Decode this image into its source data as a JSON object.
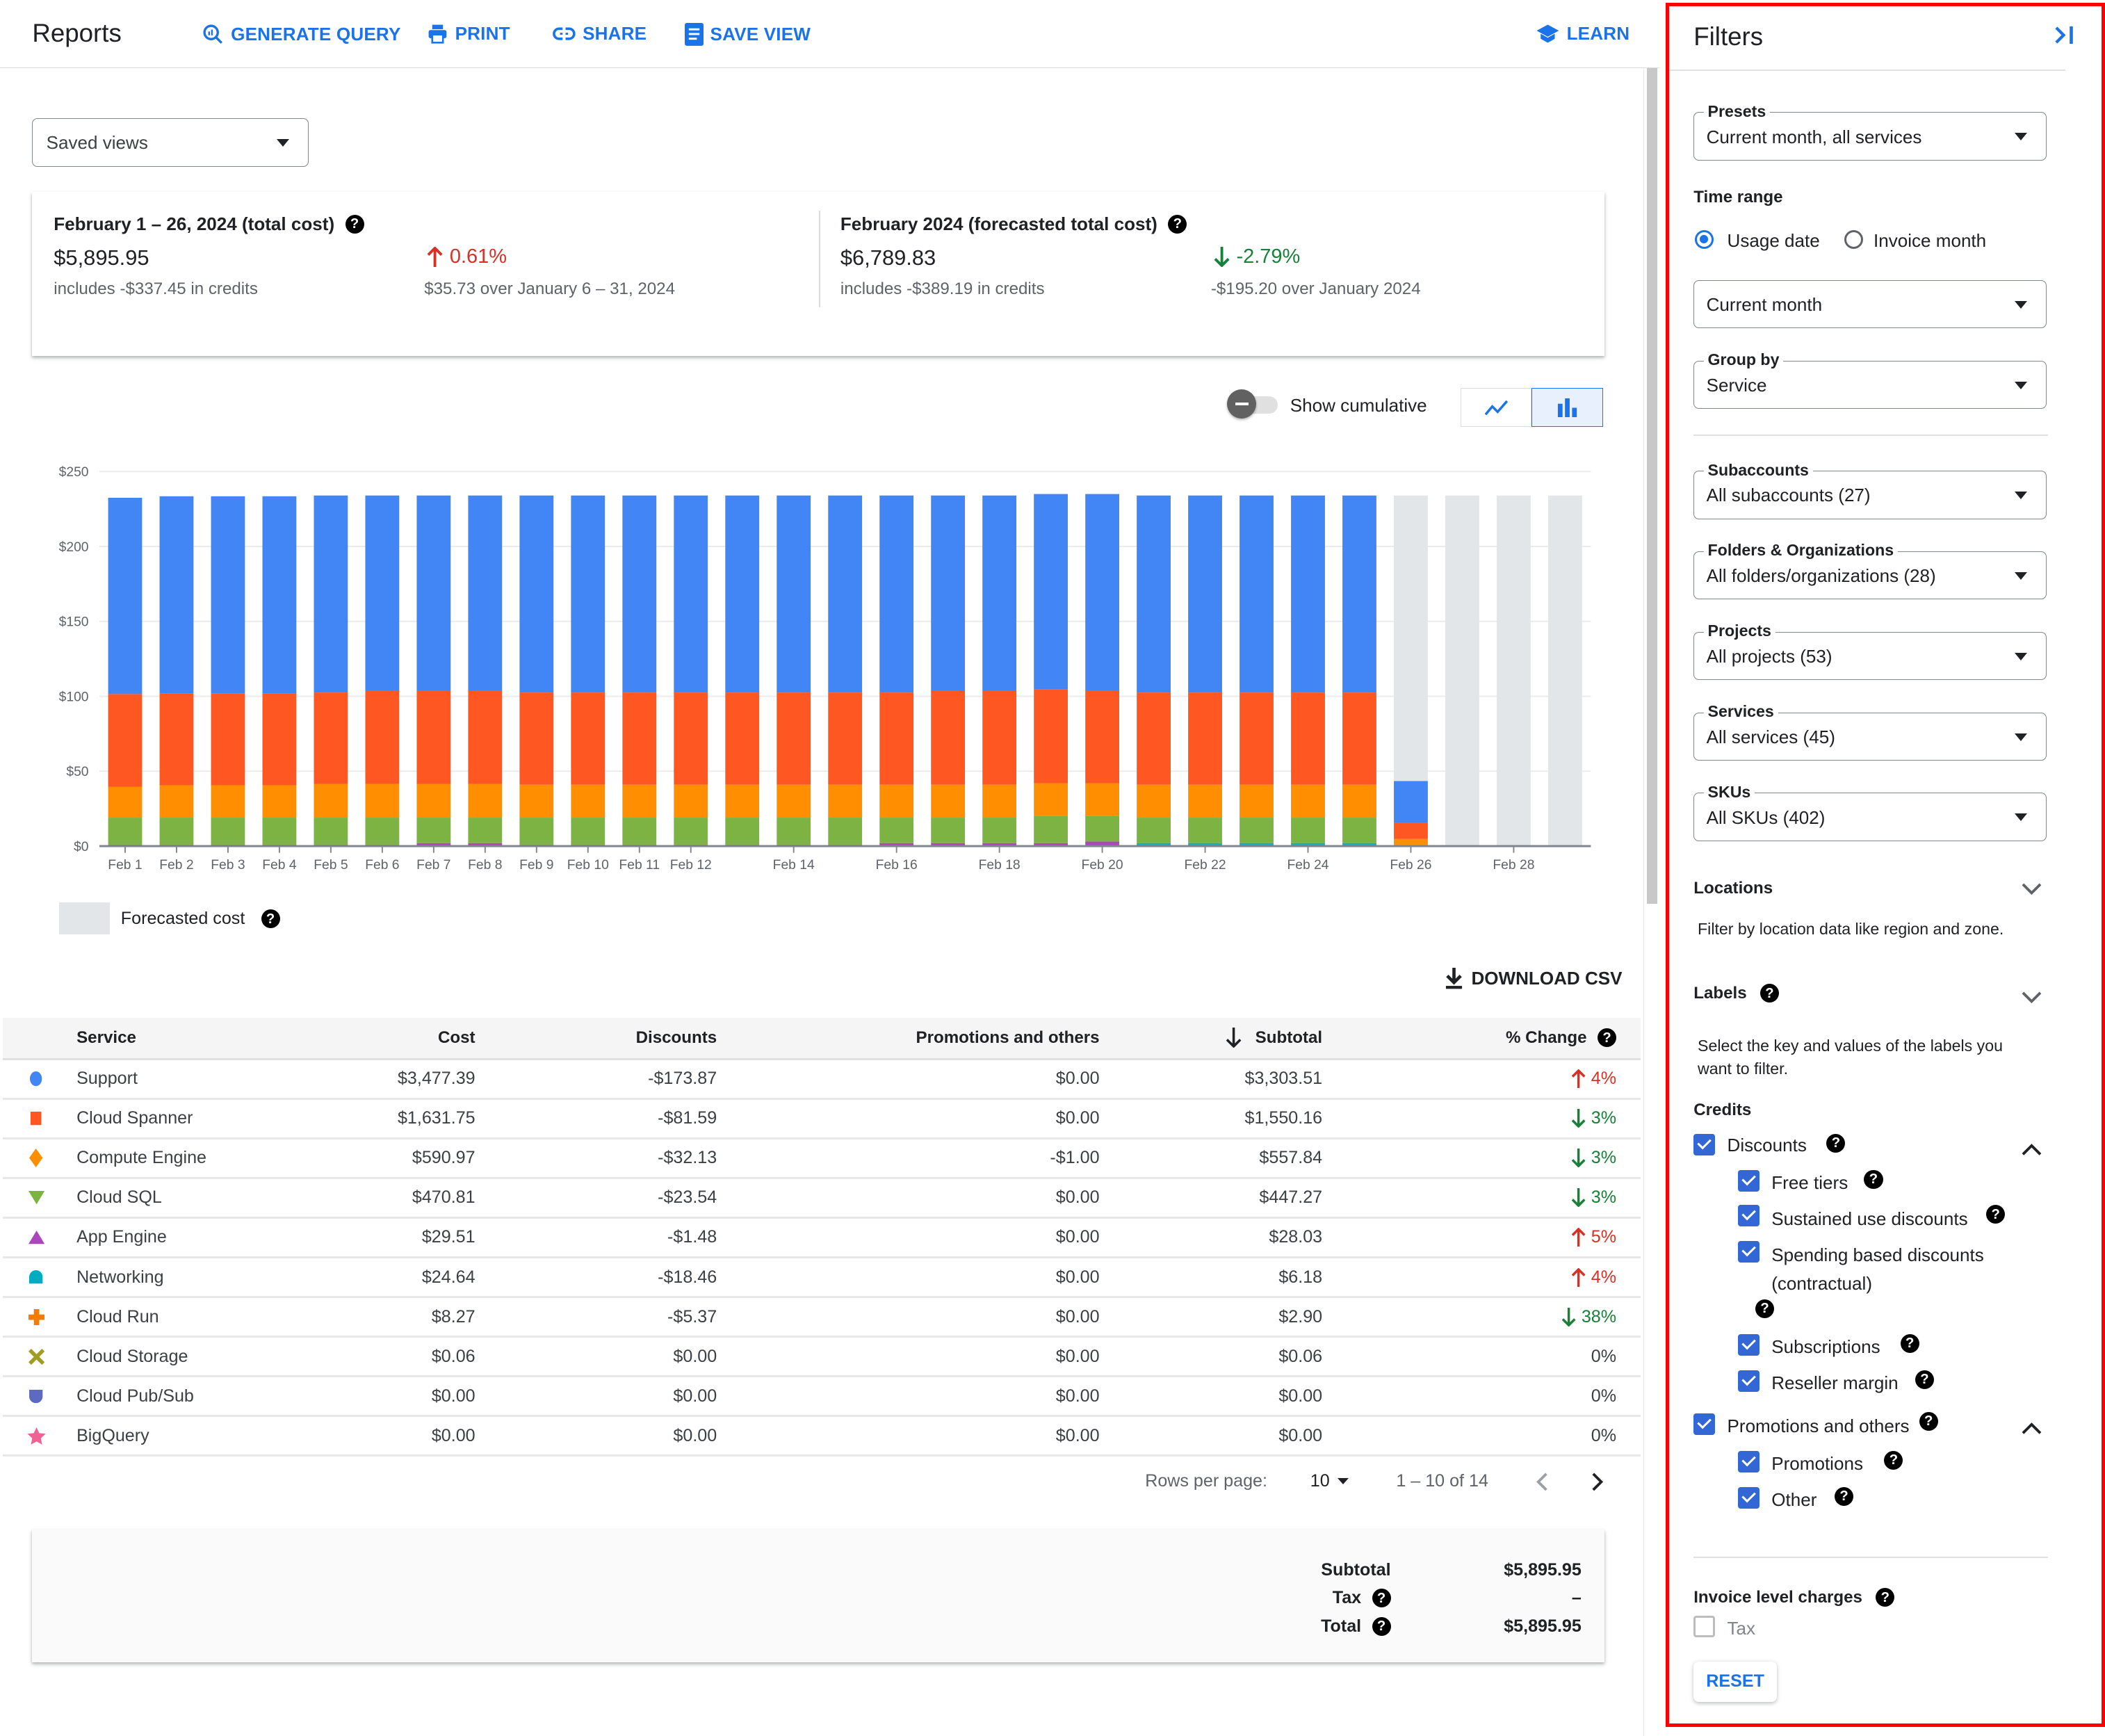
{
  "header": {
    "title": "Reports",
    "generate_query": "GENERATE QUERY",
    "print": "PRINT",
    "share": "SHARE",
    "save_view": "SAVE VIEW",
    "learn": "LEARN"
  },
  "saved_views": {
    "value": "Saved views"
  },
  "summary": {
    "left": {
      "heading": "February 1 – 26, 2024 (total cost)",
      "amount": "$5,895.95",
      "credits": "includes -$337.45 in credits",
      "change": "0.61%",
      "change_direction": "up",
      "comparison": "$35.73 over January 6 – 31, 2024"
    },
    "right": {
      "heading": "February 2024 (forecasted total cost)",
      "amount": "$6,789.83",
      "credits": "includes -$389.19 in credits",
      "change": "-2.79%",
      "change_direction": "down",
      "comparison": "-$195.20 over January 2024"
    }
  },
  "chart_controls": {
    "show_cumulative_label": "Show cumulative",
    "show_cumulative_on": false,
    "chart_type_options": [
      "line",
      "bar"
    ],
    "chart_type_selected": "bar"
  },
  "chart_data": {
    "type": "bar",
    "stacked": true,
    "title": "",
    "xlabel": "",
    "ylabel": "",
    "ylim": [
      0,
      250
    ],
    "yticks": [
      "$0",
      "$50",
      "$100",
      "$150",
      "$200",
      "$250"
    ],
    "ytick_values": [
      0,
      50,
      100,
      150,
      200,
      250
    ],
    "grid": true,
    "categories": [
      "Feb 1",
      "Feb 2",
      "Feb 3",
      "Feb 4",
      "Feb 5",
      "Feb 6",
      "Feb 7",
      "Feb 8",
      "Feb 9",
      "Feb 10",
      "Feb 11",
      "Feb 12",
      "Feb 13",
      "Feb 14",
      "Feb 15",
      "Feb 16",
      "Feb 17",
      "Feb 18",
      "Feb 19",
      "Feb 20",
      "Feb 21",
      "Feb 22",
      "Feb 23",
      "Feb 24",
      "Feb 25",
      "Feb 26",
      "Feb 27",
      "Feb 28",
      "Feb 29"
    ],
    "tick_labels": [
      "Feb 1",
      "Feb 2",
      "Feb 3",
      "Feb 4",
      "Feb 5",
      "Feb 6",
      "Feb 7",
      "Feb 8",
      "Feb 9",
      "Feb 10",
      "Feb 11",
      "Feb 12",
      "",
      "Feb 14",
      "",
      "Feb 16",
      "",
      "Feb 18",
      "",
      "Feb 20",
      "",
      "Feb 22",
      "",
      "Feb 24",
      "",
      "Feb 26",
      "",
      "Feb 28",
      ""
    ],
    "series": [
      {
        "name": "App Engine",
        "color": "#ab47bc",
        "values": [
          1,
          1,
          1,
          1,
          1,
          1,
          2,
          2,
          1,
          1,
          1,
          1,
          1,
          1,
          1,
          2,
          2,
          2,
          2,
          3,
          1,
          1,
          1,
          1,
          1,
          0,
          0,
          0,
          0
        ]
      },
      {
        "name": "Networking",
        "color": "#00acc1",
        "values": [
          0,
          0,
          0,
          0,
          0,
          0,
          0,
          0,
          0,
          0,
          0,
          0,
          0,
          0,
          0,
          0,
          0,
          0,
          0,
          0,
          1,
          1,
          1,
          1,
          1,
          0,
          0,
          0,
          0
        ]
      },
      {
        "name": "Cloud SQL",
        "color": "#7cb342",
        "values": [
          18,
          18,
          18,
          18,
          18,
          18,
          17,
          17,
          18,
          18,
          18,
          18,
          18,
          18,
          18,
          17,
          17,
          17,
          18,
          17,
          17,
          17,
          17,
          17,
          17,
          1,
          0,
          0,
          0
        ]
      },
      {
        "name": "Compute Engine",
        "color": "#ff8f00",
        "values": [
          20.5,
          21.5,
          21.5,
          21.5,
          22.5,
          22.5,
          22.5,
          22.5,
          22,
          22,
          22,
          22,
          22,
          22,
          22,
          22,
          22,
          22,
          22,
          22,
          22,
          22,
          22,
          22,
          22,
          3.8,
          0,
          0,
          0
        ]
      },
      {
        "name": "Cloud Spanner",
        "color": "#ff5722",
        "values": [
          62,
          61.5,
          61.5,
          61.5,
          61,
          62,
          62,
          62,
          61.5,
          61.5,
          61.5,
          61.5,
          61.5,
          61.5,
          61.5,
          61.5,
          62.5,
          62.5,
          62.5,
          61.5,
          61.5,
          61.5,
          61.5,
          61.5,
          61.5,
          10.6,
          0,
          0,
          0
        ]
      },
      {
        "name": "Support",
        "color": "#4285f4",
        "values": [
          131,
          131.5,
          131.5,
          131.5,
          131.5,
          130.5,
          130.5,
          130.5,
          131.5,
          131.5,
          131.5,
          131.5,
          131.5,
          131.5,
          131.5,
          131.5,
          130.5,
          130.5,
          130.5,
          131.5,
          131.5,
          131.5,
          131.5,
          131.5,
          131.5,
          28,
          0,
          0,
          0
        ]
      }
    ],
    "forecast": {
      "name": "Forecasted cost",
      "color": "#e3e6e8",
      "values": [
        0,
        0,
        0,
        0,
        0,
        0,
        0,
        0,
        0,
        0,
        0,
        0,
        0,
        0,
        0,
        0,
        0,
        0,
        0,
        0,
        0,
        0,
        0,
        0,
        0,
        234,
        234,
        234,
        234
      ]
    },
    "legend": [
      {
        "label": "Forecasted cost",
        "color": "#e3e6e8"
      }
    ],
    "legend_position": "bottom-left"
  },
  "download_csv": "DOWNLOAD CSV",
  "table": {
    "columns": [
      "Service",
      "Cost",
      "Discounts",
      "Promotions and others",
      "Subtotal",
      "% Change"
    ],
    "sort_column": "Subtotal",
    "sort_direction": "desc",
    "rows": [
      {
        "icon": "circle",
        "color": "#4285f4",
        "service": "Support",
        "cost": "$3,477.39",
        "discounts": "-$173.87",
        "promotions": "$0.00",
        "subtotal": "$3,303.51",
        "change": "4%",
        "direction": "up"
      },
      {
        "icon": "square",
        "color": "#ff5722",
        "service": "Cloud Spanner",
        "cost": "$1,631.75",
        "discounts": "-$81.59",
        "promotions": "$0.00",
        "subtotal": "$1,550.16",
        "change": "3%",
        "direction": "down"
      },
      {
        "icon": "diamond",
        "color": "#ff8f00",
        "service": "Compute Engine",
        "cost": "$590.97",
        "discounts": "-$32.13",
        "promotions": "-$1.00",
        "subtotal": "$557.84",
        "change": "3%",
        "direction": "down"
      },
      {
        "icon": "triangle-down",
        "color": "#7cb342",
        "service": "Cloud SQL",
        "cost": "$470.81",
        "discounts": "-$23.54",
        "promotions": "$0.00",
        "subtotal": "$447.27",
        "change": "3%",
        "direction": "down"
      },
      {
        "icon": "triangle-up",
        "color": "#ab47bc",
        "service": "App Engine",
        "cost": "$29.51",
        "discounts": "-$1.48",
        "promotions": "$0.00",
        "subtotal": "$28.03",
        "change": "5%",
        "direction": "up"
      },
      {
        "icon": "dome",
        "color": "#00acc1",
        "service": "Networking",
        "cost": "$24.64",
        "discounts": "-$18.46",
        "promotions": "$0.00",
        "subtotal": "$6.18",
        "change": "4%",
        "direction": "up"
      },
      {
        "icon": "plus",
        "color": "#f57c00",
        "service": "Cloud Run",
        "cost": "$8.27",
        "discounts": "-$5.37",
        "promotions": "$0.00",
        "subtotal": "$2.90",
        "change": "38%",
        "direction": "down"
      },
      {
        "icon": "cross",
        "color": "#9e9d24",
        "service": "Cloud Storage",
        "cost": "$0.06",
        "discounts": "$0.00",
        "promotions": "$0.00",
        "subtotal": "$0.06",
        "change": "0%",
        "direction": "none"
      },
      {
        "icon": "shield",
        "color": "#5c6bc0",
        "service": "Cloud Pub/Sub",
        "cost": "$0.00",
        "discounts": "$0.00",
        "promotions": "$0.00",
        "subtotal": "$0.00",
        "change": "0%",
        "direction": "none"
      },
      {
        "icon": "star",
        "color": "#f06292",
        "service": "BigQuery",
        "cost": "$0.00",
        "discounts": "$0.00",
        "promotions": "$0.00",
        "subtotal": "$0.00",
        "change": "0%",
        "direction": "none"
      }
    ]
  },
  "pagination": {
    "rows_per_page_label": "Rows per page:",
    "rows_per_page": "10",
    "range": "1 – 10 of 14"
  },
  "totals": {
    "subtotal_label": "Subtotal",
    "subtotal": "$5,895.95",
    "tax_label": "Tax",
    "tax": "–",
    "total_label": "Total",
    "total": "$5,895.95"
  },
  "filters": {
    "title": "Filters",
    "presets": {
      "label": "Presets",
      "value": "Current month, all services"
    },
    "time_range": {
      "label": "Time range",
      "options": [
        "Usage date",
        "Invoice month"
      ],
      "selected": "Usage date",
      "value": "Current month"
    },
    "group_by": {
      "label": "Group by",
      "value": "Service"
    },
    "subaccounts": {
      "label": "Subaccounts",
      "value": "All subaccounts (27)"
    },
    "folders": {
      "label": "Folders & Organizations",
      "value": "All folders/organizations (28)"
    },
    "projects": {
      "label": "Projects",
      "value": "All projects (53)"
    },
    "services": {
      "label": "Services",
      "value": "All services (45)"
    },
    "skus": {
      "label": "SKUs",
      "value": "All SKUs (402)"
    },
    "locations": {
      "label": "Locations",
      "description": "Filter by location data like region and zone."
    },
    "labels": {
      "label": "Labels",
      "description": "Select the key and values of the labels you want to filter."
    },
    "credits": {
      "label": "Credits",
      "discounts": {
        "label": "Discounts",
        "checked": true
      },
      "discount_items": [
        {
          "label": "Free tiers",
          "checked": true
        },
        {
          "label": "Sustained use discounts",
          "checked": true
        },
        {
          "label": "Spending based discounts (contractual)",
          "checked": true
        },
        {
          "label": "Subscriptions",
          "checked": true
        },
        {
          "label": "Reseller margin",
          "checked": true
        }
      ],
      "promotions": {
        "label": "Promotions and others",
        "checked": true
      },
      "promotion_items": [
        {
          "label": "Promotions",
          "checked": true
        },
        {
          "label": "Other",
          "checked": true
        }
      ]
    },
    "invoice_level": {
      "label": "Invoice level charges",
      "tax_label": "Tax",
      "tax_checked": false
    },
    "reset": "RESET"
  }
}
